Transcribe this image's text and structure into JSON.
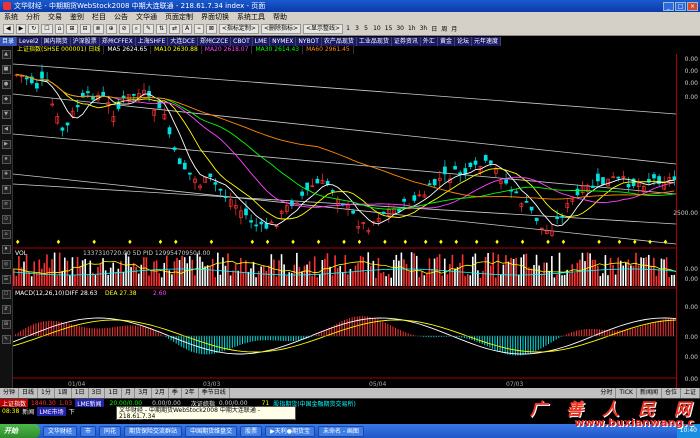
{
  "window": {
    "title": "文华财经 - 中期期货WebStock2008    中期大连联通 - 218.61.7.34    index - 页面"
  },
  "menu": [
    "系统",
    "分析",
    "交易",
    "鉴别",
    "栏目",
    "公告",
    "文华通",
    "页面定制",
    "界面切换",
    "系统工具",
    "帮助"
  ],
  "toolbar": {
    "buttons": [
      "◀",
      "▶",
      "↻",
      "☐",
      "⌂",
      "⊞",
      "⊟",
      "⊗",
      "⊕",
      "⊘",
      "⌕",
      "✎",
      "⇅",
      "⇄",
      "A",
      "⌁",
      "⊠"
    ],
    "dropdowns": [
      "<指标定制>",
      "<删除指标>",
      "<显示整线>"
    ],
    "periods": [
      "1",
      "3",
      "5",
      "10",
      "15",
      "30",
      "1h",
      "3h",
      "日",
      "周",
      "月"
    ]
  },
  "market_tabs": [
    "目录",
    "Level2",
    "国内期货",
    "沪深股票",
    "郑州CFFEX",
    "上海SHFE",
    "大连DCE",
    "郑州CZCE",
    "CBOT",
    "LME",
    "NYMEX",
    "NYBOT",
    "农产品现货",
    "工业品现货",
    "证券资讯",
    "外汇",
    "黄金",
    "论坛",
    "元年速度"
  ],
  "sub_tabs": [
    "上证指数(SHSE 000001) 日线",
    "MA5 2624.65",
    "MA10 2630.88",
    "MA20 2618.07",
    "MA30 2614.43",
    "MA60 2961.45"
  ],
  "panels": {
    "vol_label": "VOL",
    "vol_values": "1337310720.00   5D PID   129954709504.00",
    "macd_label": "MACD(12,26,10)",
    "macd_values": [
      "DIFF 28.63",
      "DEA 27.38",
      "2.60"
    ]
  },
  "axis_labels": [
    "0.00",
    "0.00",
    "0.00",
    "0.00",
    "2500.00",
    "0.00",
    "0.00",
    "0.00",
    "0.00",
    "0.00",
    "0.00"
  ],
  "x_labels": [
    "01/04",
    "03/03",
    "05/04",
    "07/03"
  ],
  "bottom_tabs": [
    "分钟",
    "日线",
    "1分",
    "1周",
    "1日",
    "3日",
    "1日",
    "月",
    "3月",
    "2月",
    "季",
    "2年",
    "季节日线"
  ],
  "bottom_right": [
    "分时",
    "TICK",
    "新闻闻",
    "仓位",
    "上证"
  ],
  "status1": {
    "a": "上证指数",
    "b": "1840.30",
    "c": "1.03",
    "d": "LME新闻",
    "e": "20.00/0.00",
    "f": "0.00/0.00",
    "g": "次证综指",
    "h": "0.00/0.00",
    "i": "71",
    "j": "股指期货(中国金融期货交易所)"
  },
  "status2": {
    "time": "08:38",
    "name": "新闻",
    "item": "LME市场",
    "tag": "下"
  },
  "popup": {
    "line1": "文华财经 - 中期期货WebStock2008    中期大连联通 - 218.61.7.34",
    "line2": "index - 页面"
  },
  "taskbar": {
    "start": "开始",
    "tasks": [
      "文华财经",
      "市",
      "同花",
      "期货保险交流群站",
      "中国期货维盘交",
      "股票",
      "▶天利●期货宝",
      "未命名 - 画图"
    ],
    "clock": "10:40"
  },
  "watermark": {
    "cn": "广　善　人　民　网",
    "url": "www.buxianwang.c"
  },
  "colors": {
    "up": "#ff3232",
    "down": "#00e0e0",
    "ma5": "#ffffff",
    "ma10": "#ffff00",
    "ma20": "#ff44ff",
    "ma30": "#00ff00",
    "ma60": "#ff8800"
  }
}
